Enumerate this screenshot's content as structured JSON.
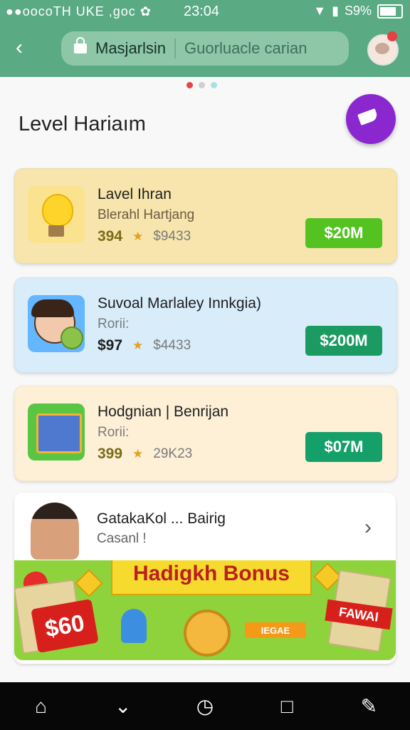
{
  "status_bar": {
    "left_text": "●●oocoTH UKE ,goc ✿",
    "time": "23:04",
    "battery": "S9%"
  },
  "header": {
    "site_name": "Masjarlsin",
    "search_text": "Guorluacle carian",
    "back_label": "‹"
  },
  "page": {
    "title": "Level Hariaım"
  },
  "cards": [
    {
      "title": "Lavel Ihran",
      "subtitle": "Blerahl Hartjang",
      "price": "394",
      "old_price": "$9433",
      "button": "$20M"
    },
    {
      "title": "Suvoal Marlaley Innkgia)",
      "subtitle": "Rorii:",
      "price": "$97",
      "old_price": "$4433",
      "button": "$200M"
    },
    {
      "title": "Hodgnian | Benrijan",
      "subtitle": "Rorii:",
      "price": "399",
      "old_price": "29K23",
      "button": "$07M"
    }
  ],
  "promo": {
    "name": "GatakaKol ... Bairig",
    "meta": "Casanl !",
    "banner_title": "Hadigkh Bonus",
    "left_badge": "$60",
    "arrow_label": "IEGAE",
    "right_badge": "FAWAI"
  },
  "icons": {
    "back": "chevron-left-icon",
    "lock": "lock-icon",
    "avatar": "avatar-icon",
    "fab": "megaphone-icon",
    "star": "star-icon",
    "chevron": "chevron-right-icon",
    "nav": [
      "home-icon",
      "down-chevron-icon",
      "clock-icon",
      "square-icon",
      "edit-icon"
    ]
  },
  "navbar": {
    "home": "⌂",
    "down": "⌄",
    "clock": "◷",
    "square": "□",
    "edit": "✎"
  }
}
